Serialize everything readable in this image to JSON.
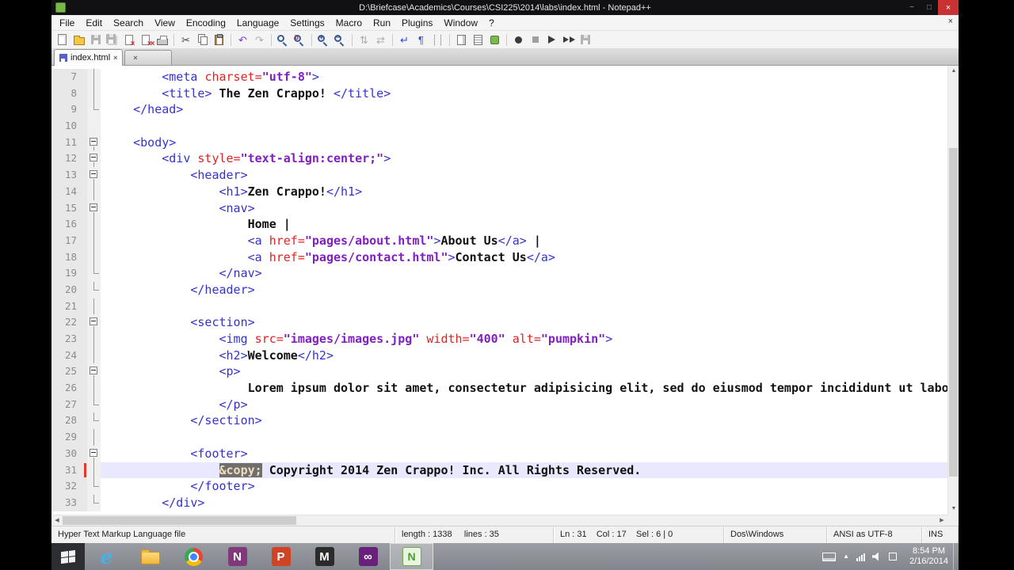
{
  "window": {
    "title": "D:\\Briefcase\\Academics\\Courses\\CSI225\\2014\\labs\\index.html - Notepad++"
  },
  "glyphs": {
    "close": "×",
    "min": "−",
    "max": "□",
    "up": "▲",
    "down": "▼",
    "left": "◀",
    "right": "▶"
  },
  "menu": {
    "items": [
      "File",
      "Edit",
      "Search",
      "View",
      "Encoding",
      "Language",
      "Settings",
      "Macro",
      "Run",
      "Plugins",
      "Window",
      "?"
    ]
  },
  "toolbar": {
    "items": [
      {
        "name": "new-file-icon",
        "kind": "page"
      },
      {
        "name": "open-file-icon",
        "kind": "folder"
      },
      {
        "name": "save-file-icon",
        "kind": "floppy",
        "dis": true
      },
      {
        "name": "save-all-icon",
        "kind": "floppy2",
        "dis": true
      },
      {
        "name": "close-file-icon",
        "kind": "closex"
      },
      {
        "name": "close-all-icon",
        "kind": "closex2"
      },
      {
        "name": "print-icon",
        "kind": "printer"
      },
      {
        "sep": true
      },
      {
        "name": "cut-icon",
        "kind": "glyph",
        "glyph": "✂",
        "fg": "#444444"
      },
      {
        "name": "copy-icon",
        "kind": "copy"
      },
      {
        "name": "paste-icon",
        "kind": "paste"
      },
      {
        "sep": true
      },
      {
        "name": "undo-icon",
        "kind": "glyph",
        "glyph": "↶",
        "fg": "#7b3fbf"
      },
      {
        "name": "redo-icon",
        "kind": "glyph",
        "glyph": "↷",
        "fg": "#7b3fbf",
        "dis": true
      },
      {
        "sep": true
      },
      {
        "name": "find-icon",
        "kind": "mag"
      },
      {
        "name": "replace-icon",
        "kind": "magr"
      },
      {
        "sep": true
      },
      {
        "name": "zoom-in-icon",
        "kind": "magp"
      },
      {
        "name": "zoom-out-icon",
        "kind": "magm"
      },
      {
        "sep": true
      },
      {
        "name": "sync-vertical-scrolling-icon",
        "kind": "glyph",
        "glyph": "⇅",
        "fg": "#555555",
        "dis": true
      },
      {
        "name": "sync-horizontal-scrolling-icon",
        "kind": "glyph",
        "glyph": "⇄",
        "fg": "#555555",
        "dis": true
      },
      {
        "sep": true
      },
      {
        "name": "word-wrap-icon",
        "kind": "glyph",
        "glyph": "↵",
        "fg": "#2a4fd0"
      },
      {
        "name": "show-all-characters-icon",
        "kind": "glyph",
        "glyph": "¶",
        "fg": "#2a4fd0"
      },
      {
        "name": "show-indent-guide-icon",
        "kind": "indent"
      },
      {
        "sep": true
      },
      {
        "name": "document-map-icon",
        "kind": "docmap"
      },
      {
        "name": "function-list-icon",
        "kind": "funclist"
      },
      {
        "name": "plugin-icon",
        "kind": "plug"
      },
      {
        "sep": true
      },
      {
        "name": "macro-record-icon",
        "kind": "dot"
      },
      {
        "name": "macro-stop-icon",
        "kind": "square",
        "dis": true
      },
      {
        "name": "macro-play-icon",
        "kind": "tri"
      },
      {
        "name": "macro-run-multiple-icon",
        "kind": "tri2"
      },
      {
        "name": "macro-save-icon",
        "kind": "floppy",
        "dis": true
      }
    ]
  },
  "tabs": [
    {
      "label": "index.html",
      "active": true,
      "saved": true
    },
    {
      "label": "",
      "active": false
    }
  ],
  "editor": {
    "lines": [
      {
        "n": 7,
        "fold": "v",
        "segs": [
          [
            "        ",
            "pl"
          ],
          [
            "<meta ",
            "tag"
          ],
          [
            "charset=",
            "attr"
          ],
          [
            "\"utf-8\"",
            "val"
          ],
          [
            ">",
            "tag"
          ]
        ]
      },
      {
        "n": 8,
        "fold": "v",
        "segs": [
          [
            "        ",
            "pl"
          ],
          [
            "<title>",
            "tag"
          ],
          [
            " The Zen Crappo! ",
            "txt"
          ],
          [
            "</title>",
            "tag"
          ]
        ]
      },
      {
        "n": 9,
        "fold": "e",
        "segs": [
          [
            "    ",
            "pl"
          ],
          [
            "</head>",
            "tag"
          ]
        ]
      },
      {
        "n": 10,
        "fold": "",
        "segs": []
      },
      {
        "n": 11,
        "fold": "b",
        "segs": [
          [
            "    ",
            "pl"
          ],
          [
            "<body>",
            "tag"
          ]
        ]
      },
      {
        "n": 12,
        "fold": "b",
        "segs": [
          [
            "        ",
            "pl"
          ],
          [
            "<div ",
            "tag"
          ],
          [
            "style=",
            "attr"
          ],
          [
            "\"text-align:center;\"",
            "val"
          ],
          [
            ">",
            "tag"
          ]
        ]
      },
      {
        "n": 13,
        "fold": "b",
        "segs": [
          [
            "            ",
            "pl"
          ],
          [
            "<header>",
            "tag"
          ]
        ]
      },
      {
        "n": 14,
        "fold": "v",
        "segs": [
          [
            "                ",
            "pl"
          ],
          [
            "<h1>",
            "tag"
          ],
          [
            "Zen Crappo!",
            "txt"
          ],
          [
            "</h1>",
            "tag"
          ]
        ]
      },
      {
        "n": 15,
        "fold": "b",
        "segs": [
          [
            "                ",
            "pl"
          ],
          [
            "<nav>",
            "tag"
          ]
        ]
      },
      {
        "n": 16,
        "fold": "v",
        "segs": [
          [
            "                    ",
            "pl"
          ],
          [
            "Home |",
            "txt"
          ]
        ]
      },
      {
        "n": 17,
        "fold": "v",
        "segs": [
          [
            "                    ",
            "pl"
          ],
          [
            "<a ",
            "tag"
          ],
          [
            "href=",
            "attr"
          ],
          [
            "\"pages/about.html\"",
            "val"
          ],
          [
            ">",
            "tag"
          ],
          [
            "About Us",
            "txt"
          ],
          [
            "</a>",
            "tag"
          ],
          [
            " |",
            "txt"
          ]
        ]
      },
      {
        "n": 18,
        "fold": "v",
        "segs": [
          [
            "                    ",
            "pl"
          ],
          [
            "<a ",
            "tag"
          ],
          [
            "href=",
            "attr"
          ],
          [
            "\"pages/contact.html\"",
            "val"
          ],
          [
            ">",
            "tag"
          ],
          [
            "Contact Us",
            "txt"
          ],
          [
            "</a>",
            "tag"
          ]
        ]
      },
      {
        "n": 19,
        "fold": "e",
        "segs": [
          [
            "                ",
            "pl"
          ],
          [
            "</nav>",
            "tag"
          ]
        ]
      },
      {
        "n": 20,
        "fold": "e",
        "segs": [
          [
            "            ",
            "pl"
          ],
          [
            "</header>",
            "tag"
          ]
        ]
      },
      {
        "n": 21,
        "fold": "v",
        "segs": []
      },
      {
        "n": 22,
        "fold": "b",
        "segs": [
          [
            "            ",
            "pl"
          ],
          [
            "<section>",
            "tag"
          ]
        ]
      },
      {
        "n": 23,
        "fold": "v",
        "segs": [
          [
            "                ",
            "pl"
          ],
          [
            "<img ",
            "tag"
          ],
          [
            "src=",
            "attr"
          ],
          [
            "\"images/images.jpg\"",
            "val"
          ],
          [
            " ",
            "pl"
          ],
          [
            "width=",
            "attr"
          ],
          [
            "\"400\"",
            "val"
          ],
          [
            " ",
            "pl"
          ],
          [
            "alt=",
            "attr"
          ],
          [
            "\"pumpkin\"",
            "val"
          ],
          [
            ">",
            "tag"
          ]
        ]
      },
      {
        "n": 24,
        "fold": "v",
        "segs": [
          [
            "                ",
            "pl"
          ],
          [
            "<h2>",
            "tag"
          ],
          [
            "Welcome",
            "txt"
          ],
          [
            "</h2>",
            "tag"
          ]
        ]
      },
      {
        "n": 25,
        "fold": "b",
        "segs": [
          [
            "                ",
            "pl"
          ],
          [
            "<p>",
            "tag"
          ]
        ]
      },
      {
        "n": 26,
        "fold": "v",
        "segs": [
          [
            "                    ",
            "pl"
          ],
          [
            "Lorem ipsum dolor sit amet, consectetur adipisicing elit, sed do eiusmod tempor incididunt ut labore",
            "txt"
          ]
        ]
      },
      {
        "n": 27,
        "fold": "e",
        "segs": [
          [
            "                ",
            "pl"
          ],
          [
            "</p>",
            "tag"
          ]
        ]
      },
      {
        "n": 28,
        "fold": "e",
        "segs": [
          [
            "            ",
            "pl"
          ],
          [
            "</section>",
            "tag"
          ]
        ]
      },
      {
        "n": 29,
        "fold": "v",
        "segs": []
      },
      {
        "n": 30,
        "fold": "b",
        "segs": [
          [
            "            ",
            "pl"
          ],
          [
            "<footer>",
            "tag"
          ]
        ]
      },
      {
        "n": 31,
        "fold": "v",
        "current": true,
        "marker": true,
        "segs": [
          [
            "                ",
            "pl"
          ],
          [
            "&copy;",
            "ent"
          ],
          [
            " ",
            "pl"
          ],
          [
            "Copyright 2014 Zen Crappo! Inc. All Rights Reserved.",
            "txt"
          ]
        ]
      },
      {
        "n": 32,
        "fold": "e",
        "segs": [
          [
            "            ",
            "pl"
          ],
          [
            "</footer>",
            "tag"
          ]
        ]
      },
      {
        "n": 33,
        "fold": "e",
        "segs": [
          [
            "        ",
            "pl"
          ],
          [
            "</div>",
            "tag"
          ]
        ]
      }
    ]
  },
  "status": {
    "doc_type": "Hyper Text Markup Language file",
    "length_lines": "length : 1338     lines : 35",
    "cursor": "Ln : 31    Col : 17    Sel : 6 | 0",
    "eol": "Dos\\Windows",
    "encoding": "ANSI as UTF-8",
    "ins": "INS"
  },
  "taskbar": {
    "items": [
      {
        "name": "start-button",
        "kind": "start"
      },
      {
        "name": "internet-explorer-icon",
        "kind": "letter",
        "glyph": "e",
        "fg": "#49b1e8"
      },
      {
        "name": "file-explorer-icon",
        "kind": "folder"
      },
      {
        "name": "chrome-icon",
        "kind": "chrome"
      },
      {
        "name": "onenote-icon",
        "kind": "tile",
        "glyph": "N",
        "bg": "#80397b"
      },
      {
        "name": "powerpoint-icon",
        "kind": "tile",
        "glyph": "P",
        "bg": "#d04423"
      },
      {
        "name": "m-app-icon",
        "kind": "tile",
        "glyph": "M",
        "bg": "#2b2b2b"
      },
      {
        "name": "visual-studio-icon",
        "kind": "tile",
        "glyph": "∞",
        "bg": "#68217a"
      },
      {
        "name": "notepad-plus-plus-icon",
        "kind": "npp",
        "glyph": "N",
        "active": true
      }
    ],
    "tray": [
      {
        "name": "touch-keyboard-icon",
        "kind": "keyboard"
      },
      {
        "name": "show-hidden-icons-chevron",
        "kind": "chev"
      },
      {
        "name": "network-icon",
        "kind": "net"
      },
      {
        "name": "volume-icon",
        "kind": "vol"
      },
      {
        "name": "action-center-icon",
        "kind": "sq"
      }
    ],
    "clock": {
      "time": "8:54 PM",
      "date": "2/16/2014"
    }
  }
}
